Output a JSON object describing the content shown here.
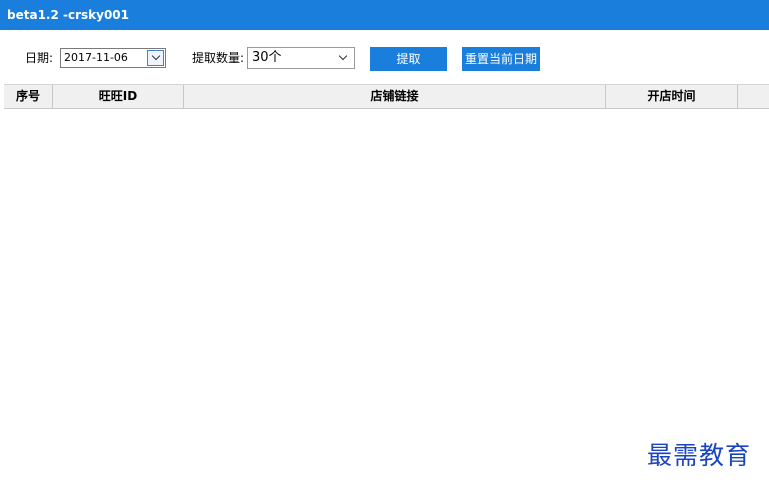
{
  "window": {
    "title": "beta1.2 -crsky001"
  },
  "toolbar": {
    "date_label": "日期:",
    "date_value": "2017-11-06",
    "count_label": "提取数量:",
    "count_value": "30个",
    "extract_button": "提取",
    "reset_button": "重置当前日期"
  },
  "grid": {
    "columns": [
      "序号",
      "旺旺ID",
      "店铺链接",
      "开店时间",
      ""
    ],
    "rows": []
  },
  "watermark": {
    "text": "最需教育"
  },
  "colors": {
    "titlebar": "#1a7fdc",
    "button": "#1a7fdc",
    "watermark": "#1a45c0"
  },
  "icons": {
    "date_dropdown": "chevron-down-icon",
    "count_dropdown": "chevron-down-icon"
  }
}
